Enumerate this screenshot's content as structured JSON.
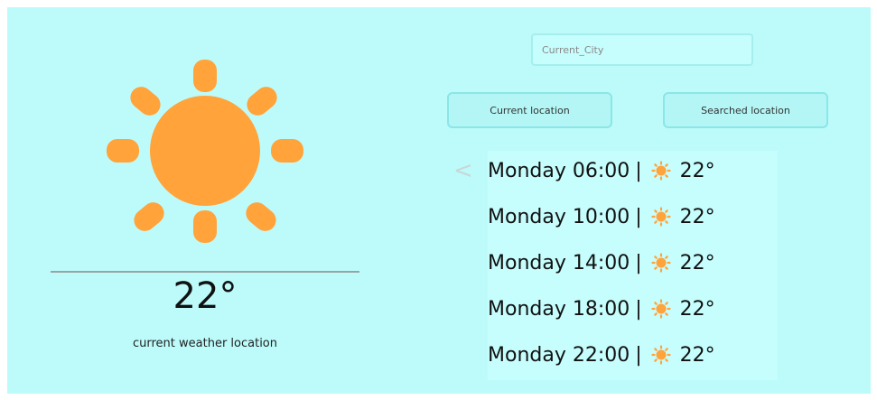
{
  "current": {
    "temperature": "22°",
    "location_label": "current weather location",
    "weather_icon": "sun-icon"
  },
  "search": {
    "placeholder": "Current_City",
    "value": ""
  },
  "buttons": {
    "current_location": "Current location",
    "searched_location": "Searched location"
  },
  "forecast": {
    "rows": [
      {
        "time": "Monday 06:00",
        "sep": "|",
        "icon": "sun-icon",
        "temp": "22°"
      },
      {
        "time": "Monday 10:00",
        "sep": "|",
        "icon": "sun-icon",
        "temp": "22°"
      },
      {
        "time": "Monday 14:00",
        "sep": "|",
        "icon": "sun-icon",
        "temp": "22°"
      },
      {
        "time": "Monday 18:00",
        "sep": "|",
        "icon": "sun-icon",
        "temp": "22°"
      },
      {
        "time": "Monday 22:00",
        "sep": "|",
        "icon": "sun-icon",
        "temp": "22°"
      }
    ],
    "prev_icon": "chevron-left-icon"
  },
  "colors": {
    "background": "#bdfbfb",
    "sun": "#ffa33a",
    "button_border": "#8be6e6"
  }
}
